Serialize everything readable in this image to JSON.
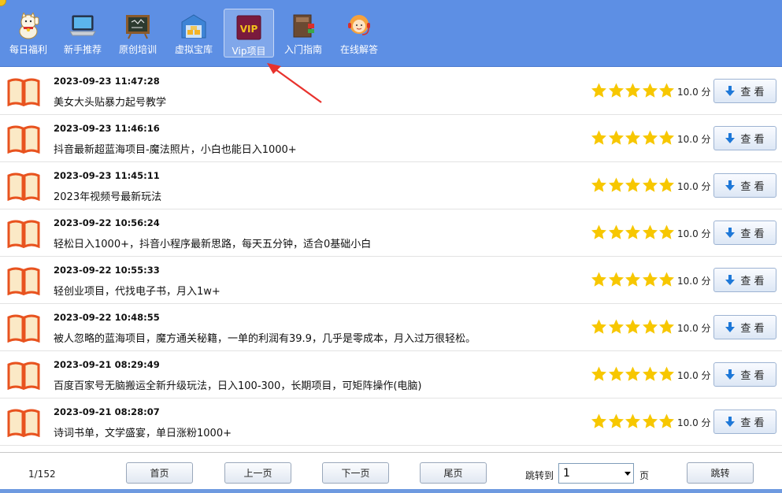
{
  "toolbar": {
    "items": [
      {
        "label": "每日福利",
        "icon": "lucky-cat-icon"
      },
      {
        "label": "新手推荐",
        "icon": "laptop-icon"
      },
      {
        "label": "原创培训",
        "icon": "blackboard-icon"
      },
      {
        "label": "虚拟宝库",
        "icon": "warehouse-icon"
      },
      {
        "label": "Vip项目",
        "icon": "vip-icon",
        "icon_text": "VIP",
        "active": true
      },
      {
        "label": "入门指南",
        "icon": "books-icon"
      },
      {
        "label": "在线解答",
        "icon": "support-agent-icon"
      }
    ]
  },
  "list": {
    "rows": [
      {
        "time": "2023-09-23 11:47:28",
        "title": "美女大头贴暴力起号教学",
        "rating": 5,
        "score": "10.0 分",
        "action": "查 看"
      },
      {
        "time": "2023-09-23 11:46:16",
        "title": "抖音最新超蓝海项目-魔法照片，小白也能日入1000+",
        "rating": 5,
        "score": "10.0 分",
        "action": "查 看"
      },
      {
        "time": "2023-09-23 11:45:11",
        "title": "2023年视频号最新玩法",
        "rating": 5,
        "score": "10.0 分",
        "action": "查 看"
      },
      {
        "time": "2023-09-22 10:56:24",
        "title": "轻松日入1000+，抖音小程序最新思路，每天五分钟，适合0基础小白",
        "rating": 5,
        "score": "10.0 分",
        "action": "查 看"
      },
      {
        "time": "2023-09-22 10:55:33",
        "title": "轻创业项目，代找电子书，月入1w+",
        "rating": 5,
        "score": "10.0 分",
        "action": "查 看"
      },
      {
        "time": "2023-09-22 10:48:55",
        "title": "被人忽略的蓝海项目，魔方通关秘籍，一单的利润有39.9，几乎是零成本，月入过万很轻松。",
        "rating": 5,
        "score": "10.0 分",
        "action": "查 看"
      },
      {
        "time": "2023-09-21 08:29:49",
        "title": "百度百家号无脑搬运全新升级玩法，日入100-300，长期项目，可矩阵操作(电脑)",
        "rating": 5,
        "score": "10.0 分",
        "action": "查 看"
      },
      {
        "time": "2023-09-21 08:28:07",
        "title": "诗词书单，文学盛宴，单日涨粉1000+",
        "rating": 5,
        "score": "10.0 分",
        "action": "查 看"
      }
    ]
  },
  "pager": {
    "info": "1/152",
    "first": "首页",
    "prev": "上一页",
    "next": "下一页",
    "last": "尾页",
    "jump_label": "跳转到",
    "jump_value": "1",
    "page_unit": "页",
    "go": "跳转"
  },
  "colors": {
    "toolbar_bg": "#5d8fe4",
    "star": "#f7c700",
    "book": "#e8531f",
    "download_arrow": "#1e78d8",
    "annotation_arrow": "#e8322d"
  }
}
